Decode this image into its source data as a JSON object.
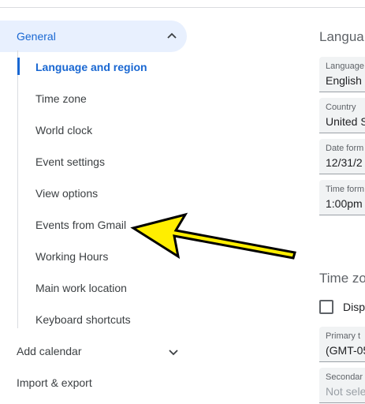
{
  "sidebar": {
    "general_label": "General",
    "items": [
      {
        "label": "Language and region",
        "active": true
      },
      {
        "label": "Time zone"
      },
      {
        "label": "World clock"
      },
      {
        "label": "Event settings"
      },
      {
        "label": "View options"
      },
      {
        "label": "Events from Gmail"
      },
      {
        "label": "Working Hours"
      },
      {
        "label": "Main work location"
      },
      {
        "label": "Keyboard shortcuts"
      }
    ],
    "add_calendar_label": "Add calendar",
    "import_export_label": "Import & export"
  },
  "content": {
    "language_section_title": "Langua",
    "fields": [
      {
        "label": "Language",
        "value": "English"
      },
      {
        "label": "Country",
        "value": "United S"
      },
      {
        "label": "Date form",
        "value": "12/31/2"
      },
      {
        "label": "Time form",
        "value": "1:00pm"
      }
    ],
    "timezone_section_title": "Time zo",
    "display_checkbox_label": "Disp",
    "timezone_fields": [
      {
        "label": "Primary t",
        "value": "(GMT-05"
      },
      {
        "label": "Secondar",
        "value": "Not sele"
      }
    ]
  },
  "colors": {
    "accent": "#1967d2",
    "selected_bg": "#e8f0fe",
    "arrow_fill": "#ffee00"
  },
  "icons": [
    "chevron-up-icon",
    "chevron-down-icon",
    "annotation-arrow-icon"
  ]
}
